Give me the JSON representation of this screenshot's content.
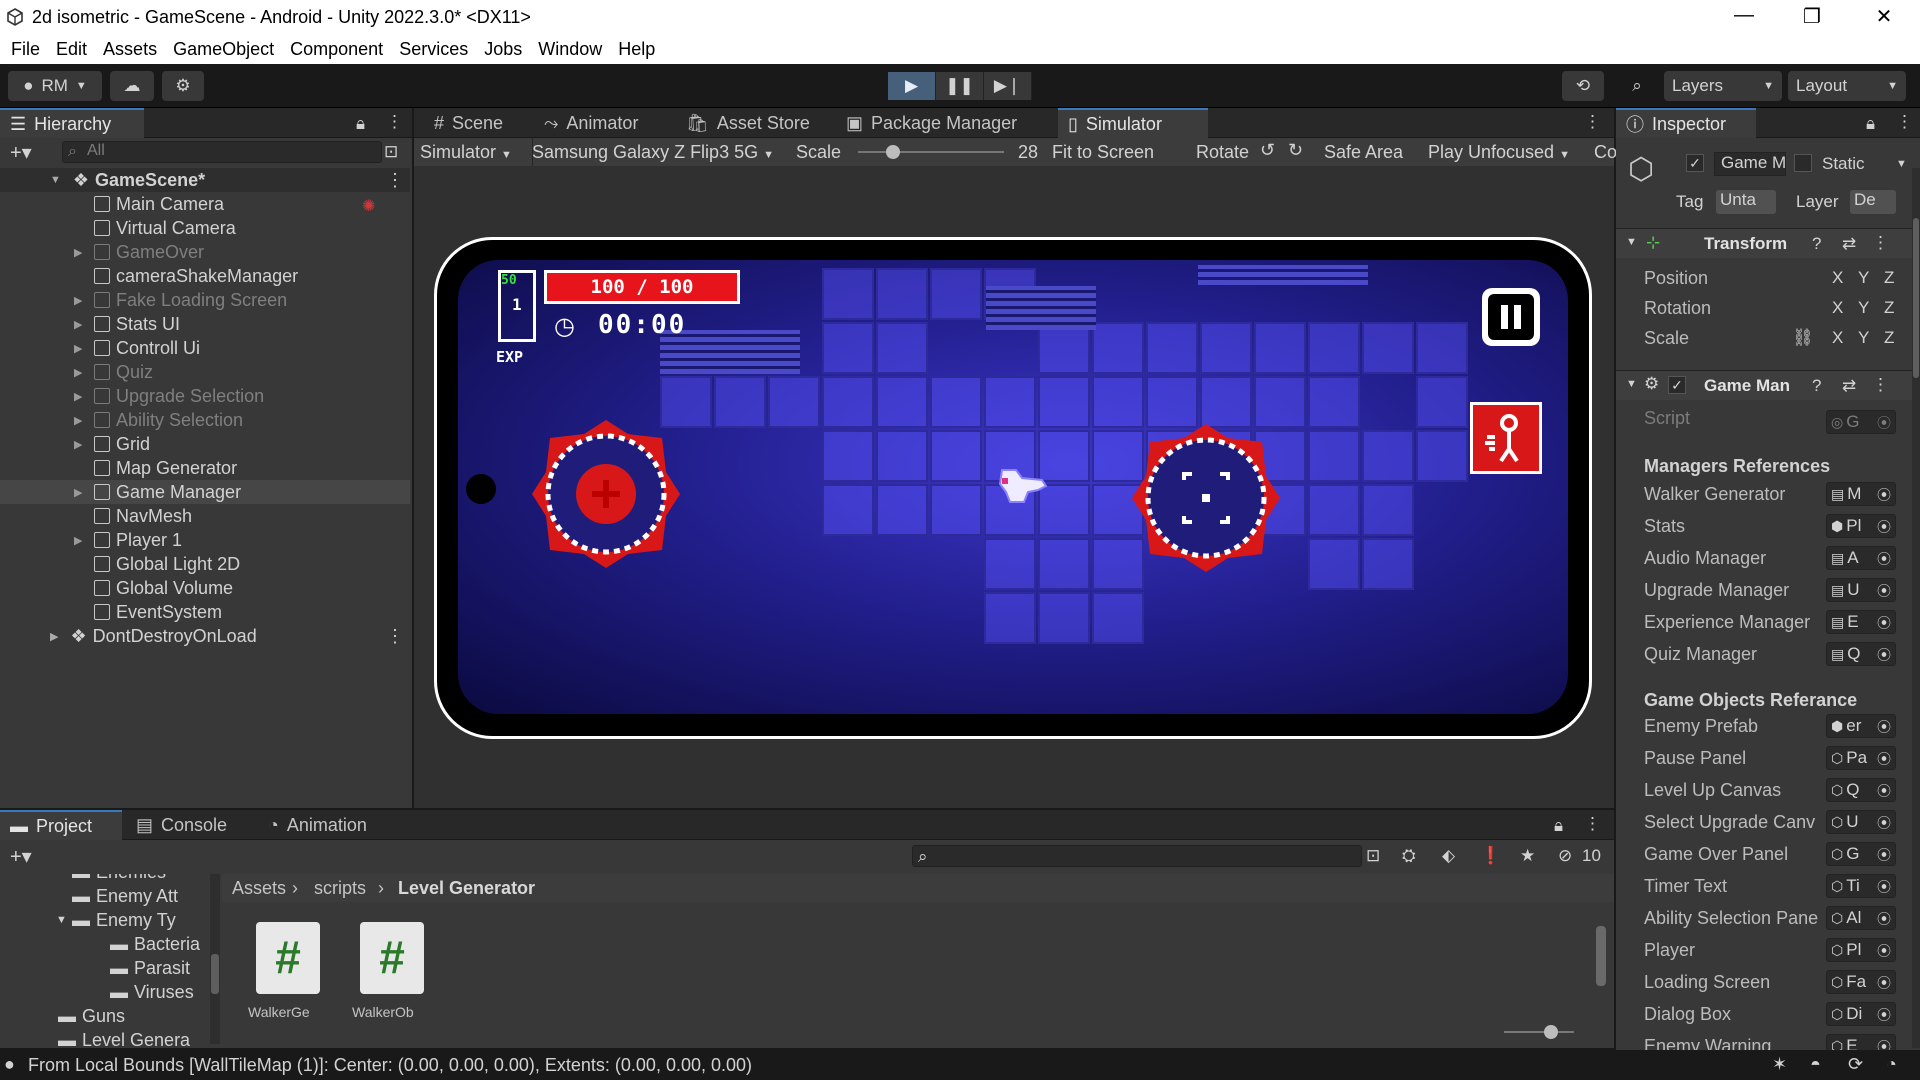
{
  "window": {
    "title": "2d isometric - GameScene - Android - Unity 2022.3.0* <DX11>"
  },
  "menu": [
    "File",
    "Edit",
    "Assets",
    "GameObject",
    "Component",
    "Services",
    "Jobs",
    "Window",
    "Help"
  ],
  "toolbar": {
    "account": "RM",
    "layers": "Layers",
    "layout": "Layout"
  },
  "hierarchy": {
    "tab": "Hierarchy",
    "search_placeholder": "All",
    "scene": "GameScene*",
    "items": [
      {
        "label": "Main Camera",
        "dim": false,
        "arrow": false
      },
      {
        "label": "Virtual Camera",
        "dim": false,
        "arrow": false
      },
      {
        "label": "GameOver",
        "dim": true,
        "arrow": true
      },
      {
        "label": "cameraShakeManager",
        "dim": false,
        "arrow": false
      },
      {
        "label": "Fake Loading Screen",
        "dim": true,
        "arrow": true
      },
      {
        "label": "Stats UI",
        "dim": false,
        "arrow": true
      },
      {
        "label": "Controll Ui",
        "dim": false,
        "arrow": true
      },
      {
        "label": "Quiz",
        "dim": true,
        "arrow": true
      },
      {
        "label": "Upgrade Selection",
        "dim": true,
        "arrow": true
      },
      {
        "label": "Ability Selection",
        "dim": true,
        "arrow": true
      },
      {
        "label": "Grid",
        "dim": false,
        "arrow": true
      },
      {
        "label": "Map Generator",
        "dim": false,
        "arrow": false
      },
      {
        "label": "Game Manager",
        "dim": false,
        "arrow": true
      },
      {
        "label": "NavMesh",
        "dim": false,
        "arrow": false
      },
      {
        "label": "Player 1",
        "dim": false,
        "arrow": true
      },
      {
        "label": "Global Light 2D",
        "dim": false,
        "arrow": false
      },
      {
        "label": "Global Volume",
        "dim": false,
        "arrow": false
      },
      {
        "label": "EventSystem",
        "dim": false,
        "arrow": false
      }
    ],
    "ddol": "DontDestroyOnLoad"
  },
  "scene_tabs": [
    "Scene",
    "Animator",
    "Asset Store",
    "Package Manager",
    "Simulator"
  ],
  "sim_toolbar": {
    "mode": "Simulator",
    "device": "Samsung Galaxy Z Flip3 5G",
    "scale_label": "Scale",
    "scale_value": "28",
    "fit": "Fit to Screen",
    "rotate": "Rotate",
    "safe_area": "Safe Area",
    "play_mode": "Play Unfocused",
    "cut": "Co"
  },
  "game": {
    "level": "1",
    "level_top": "50",
    "exp": "EXP",
    "health": "100 / 100",
    "timer": "00:00"
  },
  "inspector": {
    "tab": "Inspector",
    "object_name": "Game M",
    "static": "Static",
    "tag_label": "Tag",
    "tag_value": "Unta",
    "layer_label": "Layer",
    "layer_value": "De",
    "transform": "Transform",
    "transform_rows": [
      "Position",
      "Rotation",
      "Scale"
    ],
    "xyz": [
      "X",
      "Y",
      "Z"
    ],
    "component": "Game Man",
    "script_label": "Script",
    "script_value": "G",
    "managers_header": "Managers References",
    "managers": [
      {
        "label": "Walker Generator",
        "value": "M"
      },
      {
        "label": "Stats",
        "value": "Pl"
      },
      {
        "label": "Audio Manager",
        "value": "A"
      },
      {
        "label": "Upgrade Manager",
        "value": "U"
      },
      {
        "label": "Experience Manager",
        "value": "E"
      },
      {
        "label": "Quiz Manager",
        "value": "Q"
      }
    ],
    "objects_header": "Game Objects Referance",
    "objects": [
      {
        "label": "Enemy Prefab",
        "value": "er"
      },
      {
        "label": "Pause Panel",
        "value": "Pa"
      },
      {
        "label": "Level Up Canvas",
        "value": "Q"
      },
      {
        "label": "Select Upgrade Canv",
        "value": "U"
      },
      {
        "label": "Game Over Panel",
        "value": "G"
      },
      {
        "label": "Timer Text",
        "value": "Ti"
      },
      {
        "label": "Ability Selection Pane",
        "value": "Al"
      },
      {
        "label": "Player",
        "value": "Pl"
      },
      {
        "label": "Loading Screen",
        "value": "Fa"
      },
      {
        "label": "Dialog Box",
        "value": "Di"
      },
      {
        "label": "Enemy Warning",
        "value": "E"
      }
    ]
  },
  "project": {
    "tabs": [
      "Project",
      "Console",
      "Animation"
    ],
    "tree": [
      {
        "label": "Enemies",
        "indent": 2
      },
      {
        "label": "Enemy Att",
        "indent": 2
      },
      {
        "label": "Enemy Ty",
        "indent": 2
      },
      {
        "label": "Bacteria",
        "indent": 3
      },
      {
        "label": "Parasit",
        "indent": 3
      },
      {
        "label": "Viruses",
        "indent": 3
      },
      {
        "label": "Guns",
        "indent": 1
      },
      {
        "label": "Level Genera",
        "indent": 1
      }
    ],
    "breadcrumb": [
      "Assets",
      "scripts",
      "Level Generator"
    ],
    "files": [
      "WalkerGe",
      "WalkerOb"
    ],
    "hidden_count": "10"
  },
  "status": {
    "message": "From Local Bounds [WallTileMap (1)]: Center: (0.00, 0.00, 0.00), Extents: (0.00, 0.00, 0.00)"
  },
  "colors": {
    "accent": "#3a79bb",
    "health": "#e8141c",
    "bg": "#383838"
  }
}
